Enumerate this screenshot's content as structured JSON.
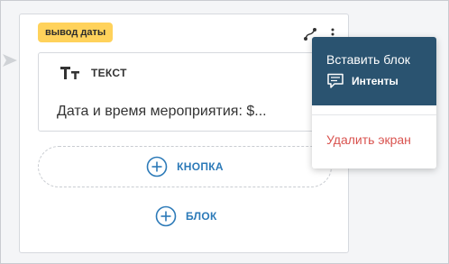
{
  "screen": {
    "badge": "вывод даты",
    "tools": {
      "connect_icon": "connect-curve-icon",
      "more_icon": "more-vertical-icon"
    }
  },
  "text_block": {
    "icon": "text-type-icon",
    "type_label": "ТЕКСТ",
    "content": "Дата и время мероприятия: $..."
  },
  "actions": {
    "add_button_label": "КНОПКА",
    "add_block_label": "БЛОК"
  },
  "context_menu": {
    "insert_block_label": "Вставить блок",
    "intents_label": "Интенты",
    "intents_icon": "chat-bubble-icon",
    "delete_screen_label": "Удалить экран"
  },
  "colors": {
    "badge": "#ffd25b",
    "accent_blue": "#2c7ab8",
    "menu_header": "#2a5370",
    "danger": "#d9534f",
    "canvas": "#f4f5f7"
  }
}
